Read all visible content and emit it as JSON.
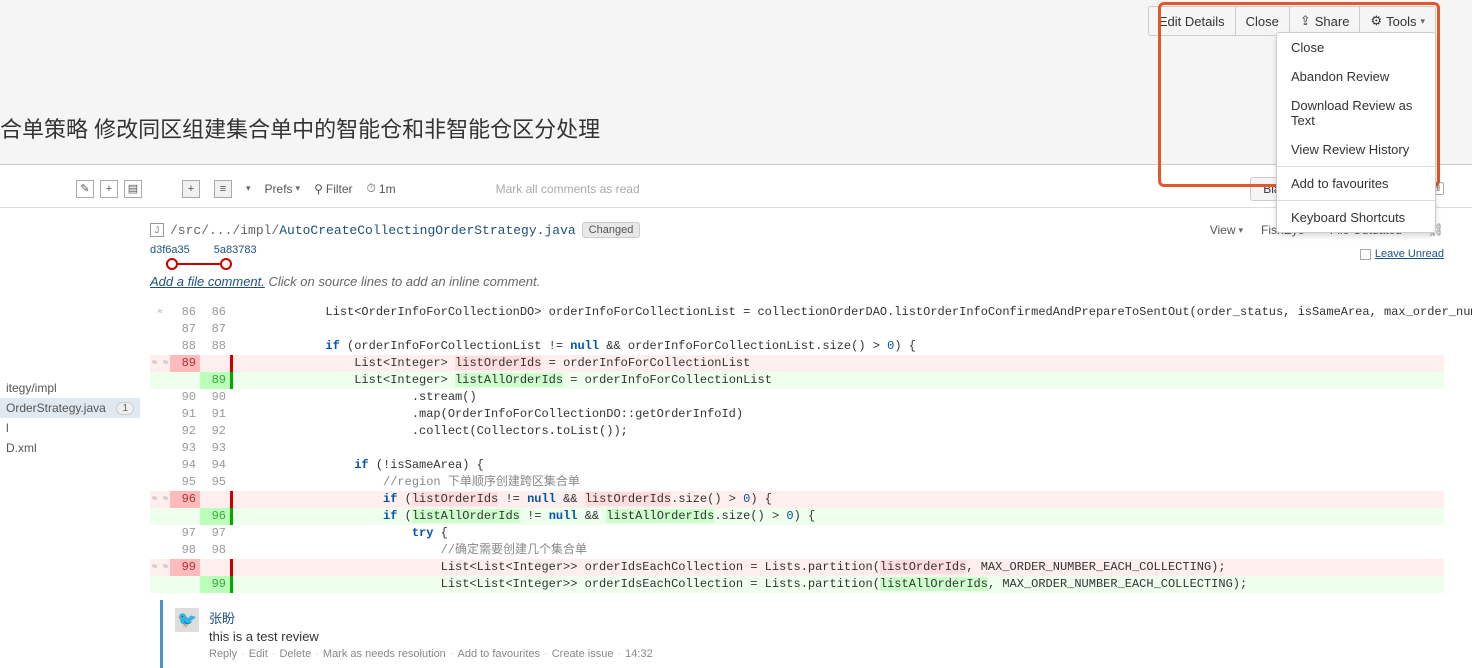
{
  "toolbar": {
    "edit_details": "Edit Details",
    "close": "Close",
    "share": "Share",
    "tools": "Tools"
  },
  "tools_menu": {
    "close": "Close",
    "abandon": "Abandon Review",
    "download": "Download Review as Text",
    "history": "View Review History",
    "add_fav": "Add to favourites",
    "shortcuts": "Keyboard Shortcuts"
  },
  "page_title": "合单策略 修改同区组建集合单中的智能仓和非智能仓区分处理",
  "mid": {
    "prefs": "Prefs",
    "filter": "Filter",
    "time": "1m",
    "mark_read": "Mark all comments as read",
    "blame": "Blame",
    "kbd": "Keyboard shortcuts"
  },
  "file": {
    "path_prefix": "/src/.../impl/",
    "path_name": "AutoCreateCollectingOrderStrategy.java",
    "changed": "Changed",
    "rev_old": "d3f6a35",
    "rev_new": "5a83783",
    "view": "View",
    "fisheye": "FishEye",
    "outdated": "File Outdated",
    "leave_unread": "Leave Unread",
    "add_comment": "Add a file comment.",
    "add_comment_hint": "Click on source lines to add an inline comment."
  },
  "sidebar": {
    "items": [
      {
        "label": "itegy/impl",
        "badge": ""
      },
      {
        "label": "OrderStrategy.java",
        "badge": "1"
      },
      {
        "label": "l",
        "badge": ""
      },
      {
        "label": "D.xml",
        "badge": ""
      }
    ]
  },
  "diff": [
    {
      "t": "ctx",
      "o": "86",
      "n": "86",
      "ctrl": "≈",
      "c": "            List<OrderInfoForCollectionDO> orderInfoForCollectionList = collectionOrderDAO.listOrderInfoConfirmedAndPrepareToSentOut(order_status, isSameArea, max_order_number);"
    },
    {
      "t": "ctx",
      "o": "87",
      "n": "87",
      "c": ""
    },
    {
      "t": "ctx",
      "o": "88",
      "n": "88",
      "c": "            if (orderInfoForCollectionList != null && orderInfoForCollectionList.size() > 0) {",
      "kw": [
        "if",
        "null"
      ],
      "num": [
        "0"
      ]
    },
    {
      "t": "del",
      "o": "89",
      "n": "",
      "ctrl": "≈ ≈",
      "c": "                List<Integer> listOrderIds = orderInfoForCollectionList",
      "hlOld": "listOrderIds"
    },
    {
      "t": "add",
      "o": "",
      "n": "89",
      "c": "                List<Integer> listAllOrderIds = orderInfoForCollectionList",
      "hlNew": "listAllOrderIds"
    },
    {
      "t": "ctx",
      "o": "90",
      "n": "90",
      "c": "                        .stream()"
    },
    {
      "t": "ctx",
      "o": "91",
      "n": "91",
      "c": "                        .map(OrderInfoForCollectionDO::getOrderInfoId)"
    },
    {
      "t": "ctx",
      "o": "92",
      "n": "92",
      "c": "                        .collect(Collectors.toList());"
    },
    {
      "t": "ctx",
      "o": "93",
      "n": "93",
      "c": ""
    },
    {
      "t": "ctx",
      "o": "94",
      "n": "94",
      "c": "                if (!isSameArea) {",
      "kw": [
        "if"
      ]
    },
    {
      "t": "ctx",
      "o": "95",
      "n": "95",
      "c": "                    //region 下单顺序创建跨区集合单",
      "cmt": true
    },
    {
      "t": "del",
      "o": "96",
      "n": "",
      "ctrl": "≈ ≈",
      "c": "                    if (listOrderIds != null && listOrderIds.size() > 0) {",
      "kw": [
        "if",
        "null"
      ],
      "num": [
        "0"
      ],
      "hlOld": "listOrderIds"
    },
    {
      "t": "add",
      "o": "",
      "n": "96",
      "c": "                    if (listAllOrderIds != null && listAllOrderIds.size() > 0) {",
      "kw": [
        "if",
        "null"
      ],
      "num": [
        "0"
      ],
      "hlNew": "listAllOrderIds"
    },
    {
      "t": "ctx",
      "o": "97",
      "n": "97",
      "c": "                        try {",
      "kw": [
        "try"
      ]
    },
    {
      "t": "ctx",
      "o": "98",
      "n": "98",
      "c": "                            //确定需要创建几个集合单",
      "cmt": true
    },
    {
      "t": "del",
      "o": "99",
      "n": "",
      "ctrl": "≈ ≈",
      "c": "                            List<List<Integer>> orderIdsEachCollection = Lists.partition(listOrderIds, MAX_ORDER_NUMBER_EACH_COLLECTING);",
      "hlOld": "listOrderIds"
    },
    {
      "t": "add",
      "o": "",
      "n": "99",
      "c": "                            List<List<Integer>> orderIdsEachCollection = Lists.partition(listAllOrderIds, MAX_ORDER_NUMBER_EACH_COLLECTING);",
      "hlNew": "listAllOrderIds"
    }
  ],
  "comment": {
    "author": "张盼",
    "text": "this is a test review",
    "actions": [
      "Reply",
      "Edit",
      "Delete",
      "Mark as needs resolution",
      "Add to favourites",
      "Create issue"
    ],
    "time": "14:32"
  }
}
